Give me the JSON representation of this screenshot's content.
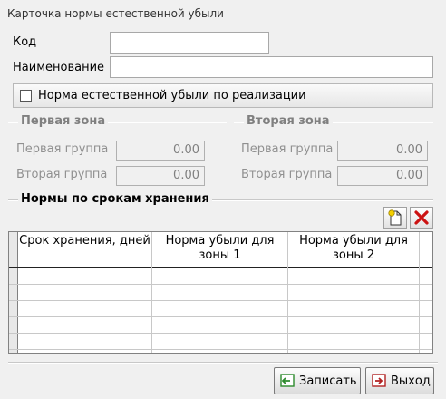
{
  "window": {
    "title": "Карточка нормы естественной убыли"
  },
  "form": {
    "code_label": "Код",
    "code_value": "",
    "name_label": "Наименование",
    "name_value": "",
    "checkbox_label": "Норма естественной убыли по реализации",
    "checkbox_checked": false
  },
  "zones": {
    "zone1_title": "Первая зона",
    "zone2_title": "Вторая зона",
    "group1_label": "Первая группа",
    "group2_label": "Вторая группа",
    "zone1_group1": "0.00",
    "zone1_group2": "0.00",
    "zone2_group1": "0.00",
    "zone2_group2": "0.00"
  },
  "norms": {
    "title": "Нормы по срокам хранения",
    "add_icon": "add-record-icon",
    "delete_icon": "delete-record-icon",
    "columns": [
      "Срок хранения, дней",
      "Норма убыли для зоны 1",
      "Норма убыли для зоны 2"
    ]
  },
  "buttons": {
    "save": "Записать",
    "exit": "Выход"
  },
  "colors": {
    "delete_red": "#cc1111",
    "save_green": "#2e8b2e",
    "exit_red": "#b22222"
  }
}
